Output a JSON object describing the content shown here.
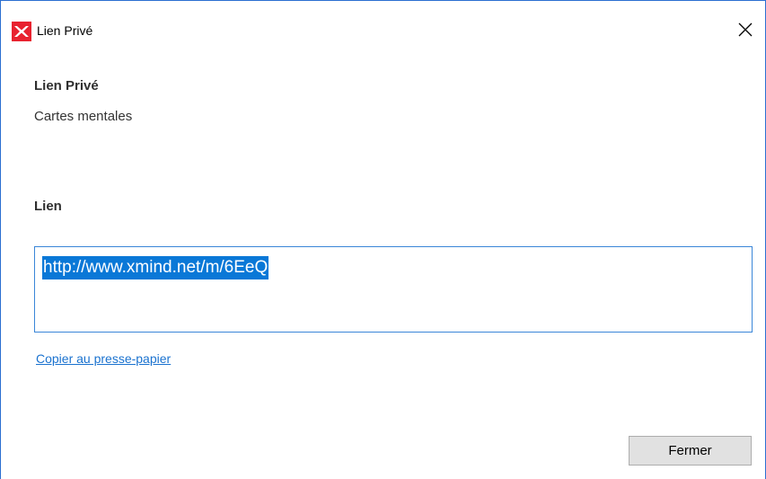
{
  "window": {
    "title": "Lien Privé",
    "app_icon": "xmind-logo-icon",
    "close_icon": "close-icon"
  },
  "content": {
    "heading": "Lien Privé",
    "subheading": "Cartes mentales",
    "link_label": "Lien",
    "link_value": "http://www.xmind.net/m/6EeQ",
    "copy_label": "Copier au presse-papier"
  },
  "footer": {
    "close_button_label": "Fermer"
  },
  "colors": {
    "accent": "#0a78d7",
    "link": "#1a72cf",
    "brand": "#e8222f",
    "window_border": "#2b6fd1"
  }
}
